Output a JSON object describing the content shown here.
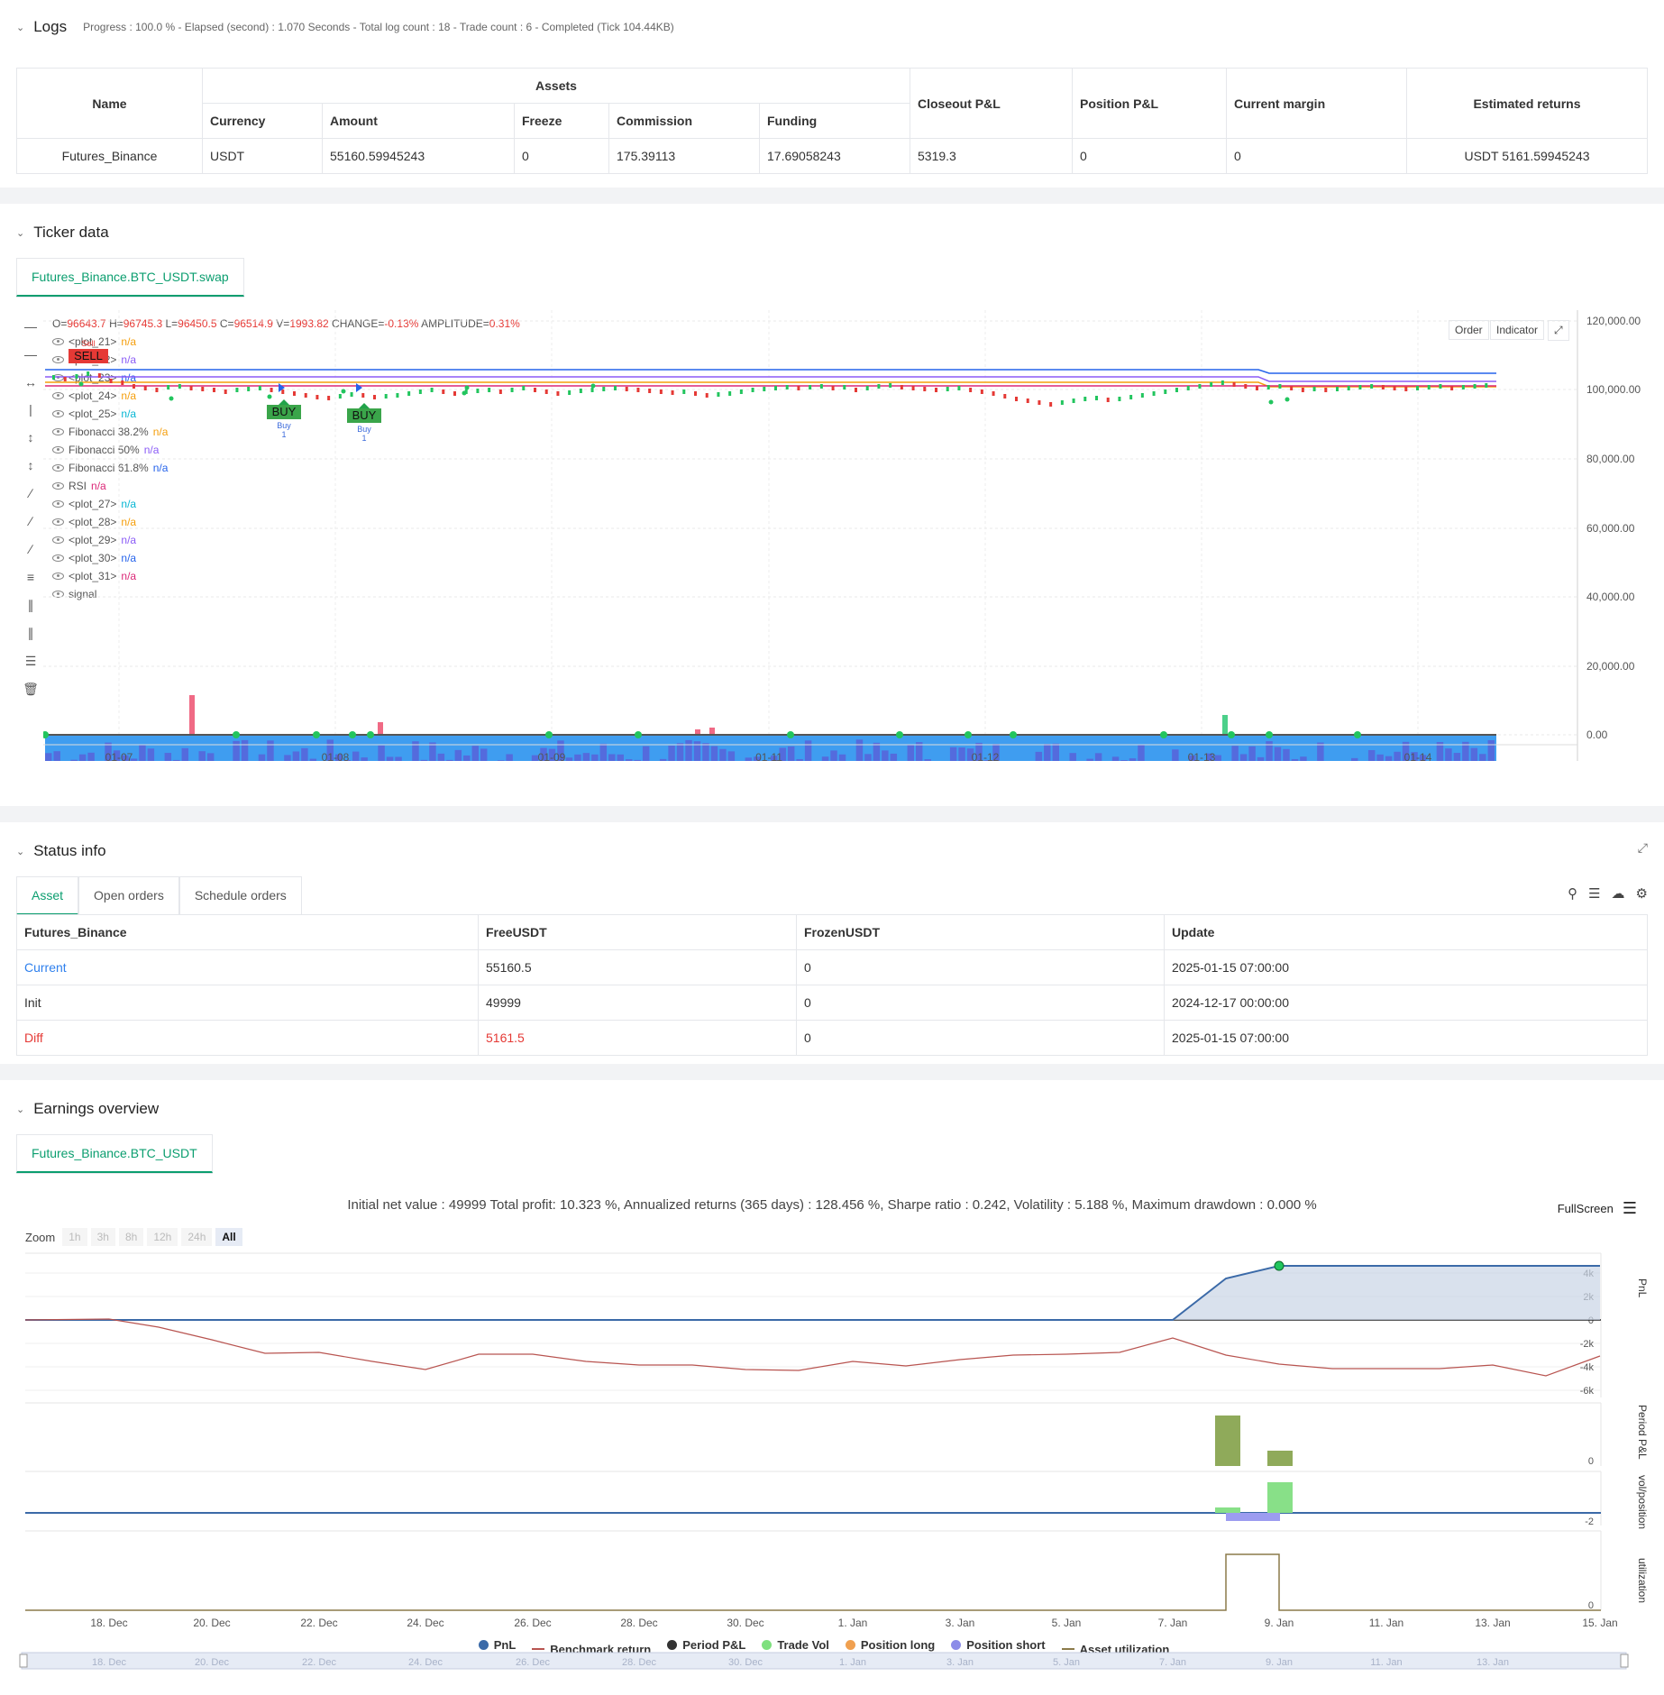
{
  "logs": {
    "title": "Logs",
    "meta": "Progress : 100.0 % - Elapsed (second) : 1.070  Seconds - Total log count : 18 - Trade count : 6 - Completed (Tick 104.44KB)",
    "table": {
      "h_name": "Name",
      "h_assets": "Assets",
      "h_currency": "Currency",
      "h_amount": "Amount",
      "h_freeze": "Freeze",
      "h_commission": "Commission",
      "h_funding": "Funding",
      "h_closeout": "Closeout P&L",
      "h_position": "Position P&L",
      "h_margin": "Current margin",
      "h_est": "Estimated returns",
      "row": {
        "name": "Futures_Binance",
        "currency": "USDT",
        "amount": "55160.59945243",
        "freeze": "0",
        "commission": "175.39113",
        "funding": "17.69058243",
        "closeout": "5319.3",
        "position": "0",
        "margin": "0",
        "est": "USDT 5161.59945243"
      }
    }
  },
  "ticker": {
    "title": "Ticker data",
    "tab": "Futures_Binance.BTC_USDT.swap",
    "ohlc": {
      "o_label": "O=",
      "o": "96643.7",
      "h_label": " H=",
      "h": "96745.3",
      "l_label": " L=",
      "l": "96450.5",
      "c_label": " C=",
      "c": "96514.9",
      "v_label": " V=",
      "v": "1993.82",
      "chg_label": " CHANGE=",
      "chg": "-0.13%",
      "amp_label": " AMPLITUDE=",
      "amp": "0.31%"
    },
    "legend": [
      {
        "name": "<plot_21>",
        "val": "n/a",
        "color": "#f59e0b"
      },
      {
        "name": "<plot_22>",
        "val": "n/a",
        "color": "#8b5cf6"
      },
      {
        "name": "<plot_23>",
        "val": "n/a",
        "color": "#2563eb"
      },
      {
        "name": "<plot_24>",
        "val": "n/a",
        "color": "#f59e0b"
      },
      {
        "name": "<plot_25>",
        "val": "n/a",
        "color": "#06b6d4"
      },
      {
        "name": "Fibonacci 38.2%",
        "val": "n/a",
        "color": "#f59e0b"
      },
      {
        "name": "Fibonacci 50%",
        "val": "n/a",
        "color": "#8b5cf6"
      },
      {
        "name": "Fibonacci 61.8%",
        "val": "n/a",
        "color": "#2563eb"
      },
      {
        "name": "RSI",
        "val": "n/a",
        "color": "#db2777"
      },
      {
        "name": "<plot_27>",
        "val": "n/a",
        "color": "#06b6d4"
      },
      {
        "name": "<plot_28>",
        "val": "n/a",
        "color": "#f59e0b"
      },
      {
        "name": "<plot_29>",
        "val": "n/a",
        "color": "#8b5cf6"
      },
      {
        "name": "<plot_30>",
        "val": "n/a",
        "color": "#2563eb"
      },
      {
        "name": "<plot_31>",
        "val": "n/a",
        "color": "#db2777"
      },
      {
        "name": "signal",
        "val": "",
        "color": "#555"
      }
    ],
    "buttons": {
      "order": "Order",
      "indicator": "Indicator"
    },
    "y_ticks": [
      "120,000.00",
      "100,000.00",
      "80,000.00",
      "60,000.00",
      "40,000.00",
      "20,000.00",
      "0.00"
    ],
    "x_ticks": [
      "01-07",
      "01-08",
      "01-09",
      "01-11",
      "01-12",
      "01-13",
      "01-14"
    ],
    "markers": {
      "sell": "SELL",
      "sell_small": "Sell",
      "buy": "BUY",
      "buy_small": "Buy",
      "one": "1"
    }
  },
  "status": {
    "title": "Status info",
    "tabs": [
      "Asset",
      "Open orders",
      "Schedule orders"
    ],
    "headers": [
      "Futures_Binance",
      "FreeUSDT",
      "FrozenUSDT",
      "Update"
    ],
    "rows": [
      {
        "label": "Current",
        "free": "55160.5",
        "frozen": "0",
        "update": "2025-01-15 07:00:00"
      },
      {
        "label": "Init",
        "free": "49999",
        "frozen": "0",
        "update": "2024-12-17 00:00:00"
      },
      {
        "label": "Diff",
        "free": "5161.5",
        "frozen": "0",
        "update": "2025-01-15 07:00:00"
      }
    ]
  },
  "earnings": {
    "title": "Earnings overview",
    "tab": "Futures_Binance.BTC_USDT",
    "summary": "Initial net value : 49999 Total profit: 10.323 %, Annualized returns (365 days) : 128.456 %, Sharpe ratio : 0.242, Volatility : 5.188 %, Maximum drawdown : 0.000 %",
    "fullscreen": "FullScreen",
    "zoom_label": "Zoom",
    "zoom_opts": [
      "1h",
      "3h",
      "8h",
      "12h",
      "24h",
      "All"
    ],
    "pnl_ticks": [
      "4k",
      "2k",
      "0",
      "-2k",
      "-4k",
      "-6k"
    ],
    "period_tick": "0",
    "vol_tick": "-2",
    "util_tick": "0",
    "side_labels": [
      "PnL",
      "Period P&L",
      "vol/position",
      "utilization"
    ],
    "x_ticks": [
      "18. Dec",
      "20. Dec",
      "22. Dec",
      "24. Dec",
      "26. Dec",
      "28. Dec",
      "30. Dec",
      "1. Jan",
      "3. Jan",
      "5. Jan",
      "7. Jan",
      "9. Jan",
      "11. Jan",
      "13. Jan",
      "15. Jan"
    ],
    "nav_ticks": [
      "18. Dec",
      "20. Dec",
      "22. Dec",
      "24. Dec",
      "26. Dec",
      "28. Dec",
      "30. Dec",
      "1. Jan",
      "3. Jan",
      "5. Jan",
      "7. Jan",
      "9. Jan",
      "11. Jan",
      "13. Jan"
    ],
    "legend": [
      {
        "name": "PnL",
        "kind": "dot",
        "color": "#3b6aa8"
      },
      {
        "name": "Benchmark return",
        "kind": "line",
        "color": "#b85450"
      },
      {
        "name": "Period P&L",
        "kind": "dot",
        "color": "#333333"
      },
      {
        "name": "Trade Vol",
        "kind": "dot",
        "color": "#7ee07e"
      },
      {
        "name": "Position long",
        "kind": "dot",
        "color": "#f0a050"
      },
      {
        "name": "Position short",
        "kind": "dot",
        "color": "#8c8ce8"
      },
      {
        "name": "Asset utilization",
        "kind": "line",
        "color": "#8b7a4a"
      }
    ]
  },
  "colors": {
    "accent": "#0b9e6f",
    "red": "#e53935",
    "blue": "#2f80ed"
  }
}
